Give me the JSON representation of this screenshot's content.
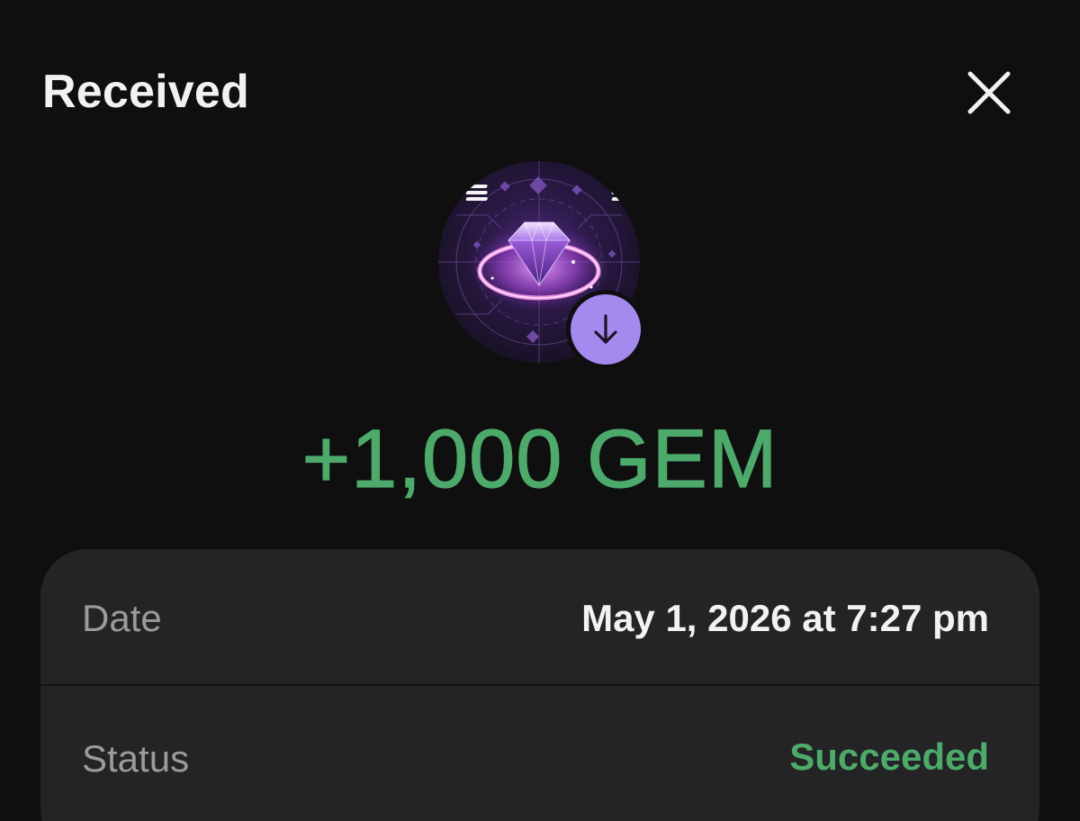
{
  "header": {
    "title": "Received",
    "close_icon": "close-icon"
  },
  "token": {
    "avatar_icon": "gem-token-icon",
    "badge_icon": "arrow-down-icon",
    "badge_color": "#a48aee"
  },
  "transaction": {
    "amount": "+1,000 GEM",
    "amount_color": "#4caa6b"
  },
  "details": {
    "date_label": "Date",
    "date_value": "May 1, 2026 at 7:27 pm",
    "status_label": "Status",
    "status_value": "Succeeded",
    "status_color": "#4caa6b"
  }
}
